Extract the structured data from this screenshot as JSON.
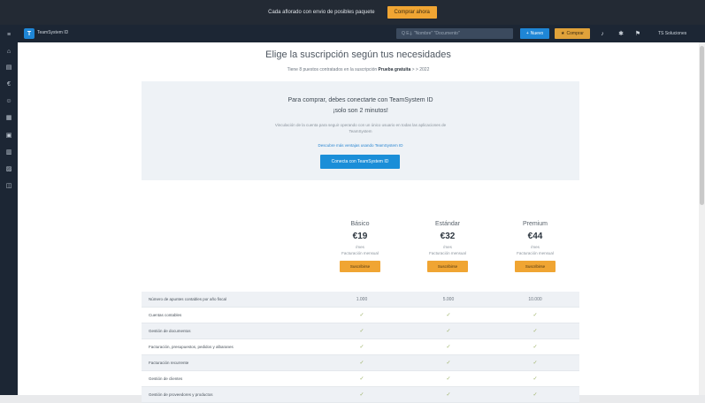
{
  "promo": {
    "text": "Cada aflorado con envio de posibles paquete",
    "button": "Comprar ahora"
  },
  "appbar": {
    "logo_letter": "T",
    "app_name": "TeamSystem ID",
    "search_placeholder": "Q  E.j. \"Nombre\" \"Documento\"",
    "btn_primary": "Nuevo",
    "btn_upgrade": "Comprar",
    "user": "TS Soluciones"
  },
  "sidebar_icons": [
    "menu-icon",
    "home-icon",
    "inbox-icon",
    "euro-icon",
    "people-icon",
    "calendar-icon",
    "cart-icon",
    "document-icon",
    "chart-icon",
    "settings-icon"
  ],
  "page": {
    "title": "Elige la suscripción según tus necesidades",
    "subtitle_prefix": "Tiene 8 puestos contratados en la suscripción",
    "subtitle_plan": "Prueba gratuita",
    "subtitle_suffix": "> > 2022"
  },
  "connect": {
    "title_line1": "Para comprar, debes conectarte con TeamSystem ID",
    "title_line2": "¡solo son 2 minutos!",
    "desc": "Vinculación de la cuenta para seguir operando con un único usuario en todas las aplicaciones de TeamSystem",
    "link": "Descubre más ventajas usando TeamSystem ID",
    "button": "Conecta con TeamSystem ID"
  },
  "plans": [
    {
      "name": "Básico",
      "price": "€19",
      "note1": "/mes",
      "note2": "Facturación mensual",
      "button": "Suscribirse"
    },
    {
      "name": "Estándar",
      "price": "€32",
      "note1": "/mes",
      "note2": "Facturación mensual",
      "button": "Suscribirse"
    },
    {
      "name": "Premium",
      "price": "€44",
      "note1": "/mes",
      "note2": "Facturación mensual",
      "button": "Suscribirse"
    }
  ],
  "features": [
    {
      "label": "Número de apuntes contables por año fiscal",
      "values": [
        "1.000",
        "5.000",
        "10.000"
      ]
    },
    {
      "label": "Cuentas contables",
      "values": [
        "✓",
        "✓",
        "✓"
      ]
    },
    {
      "label": "Gestión de documentos",
      "values": [
        "✓",
        "✓",
        "✓"
      ]
    },
    {
      "label": "Facturación, presupuestos, pedidos y albaranes",
      "values": [
        "✓",
        "✓",
        "✓"
      ]
    },
    {
      "label": "Facturación recurrente",
      "values": [
        "✓",
        "✓",
        "✓"
      ]
    },
    {
      "label": "Gestión de clientes",
      "values": [
        "✓",
        "✓",
        "✓"
      ]
    },
    {
      "label": "Gestión de proveedores y productos",
      "values": [
        "✓",
        "✓",
        "✓"
      ]
    }
  ]
}
